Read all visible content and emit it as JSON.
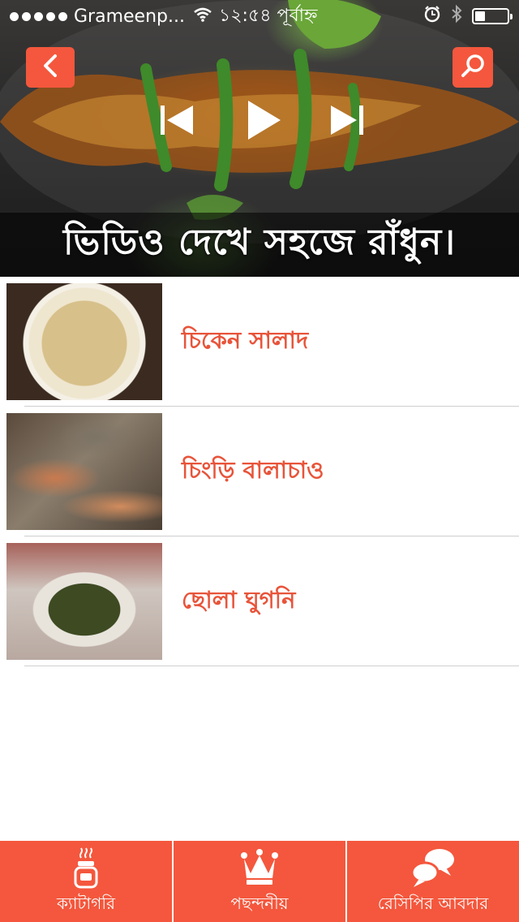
{
  "status_bar": {
    "carrier": "Grameenp...",
    "time": "১২:৫৪ পূর্বাহ্ন"
  },
  "header": {
    "back_icon": "chevron-left-icon",
    "search_icon": "search-icon",
    "banner_text": "ভিডিও দেখে সহজে রাঁধুন।",
    "media_controls": [
      "previous-icon",
      "play-icon",
      "next-icon"
    ]
  },
  "recipes": [
    {
      "title": "চিকেন সালাদ"
    },
    {
      "title": "চিংড়ি বালাচাও"
    },
    {
      "title": "ছোলা ঘুগনি"
    }
  ],
  "tabs": [
    {
      "label": "ক্যাটাগরি",
      "icon": "jar-icon"
    },
    {
      "label": "পছন্দনীয়",
      "icon": "crown-icon"
    },
    {
      "label": "রেসিপির আবদার",
      "icon": "chat-bubbles-icon"
    }
  ],
  "colors": {
    "accent": "#f4573d",
    "title_text": "#e8543a",
    "separator": "#cfcfcf"
  }
}
